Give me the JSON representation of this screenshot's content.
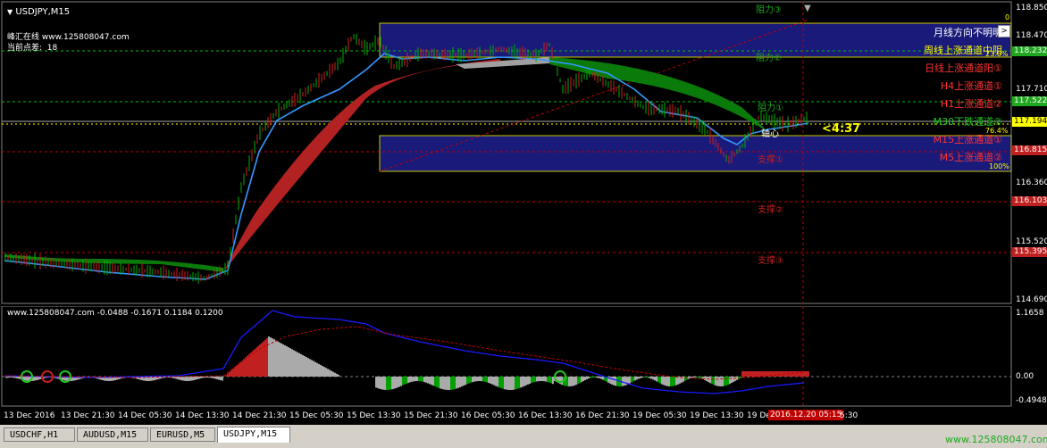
{
  "window": {
    "title": "USDJPY,M15"
  },
  "info": {
    "site": "峰汇在线 www.125808047.com",
    "spread_label": "当前点差:",
    "spread_value": "18"
  },
  "levels": {
    "res3": "阻力③",
    "res2": "阻力②",
    "res1": "阻力①",
    "pivot": "轴心",
    "sup1": "支撑①",
    "sup2": "支撑②",
    "sup3": "支撑③"
  },
  "fib": {
    "f0": "0",
    "f236": "23.6%",
    "f764": "76.4%",
    "f100": "100%"
  },
  "trend_panel": {
    "button": ">",
    "lines": [
      {
        "text": "月线方向不明明",
        "color": "#ffffff"
      },
      {
        "text": "周线上涨通道中阴",
        "color": "#ffff00"
      },
      {
        "text": "日线上涨通道阳①",
        "color": "#ff3333"
      },
      {
        "text": "H4上涨通道①",
        "color": "#ff3333"
      },
      {
        "text": "H1上涨通道②",
        "color": "#ff3333"
      },
      {
        "text": "M30下跌通道②",
        "color": "#22c322"
      },
      {
        "text": "M15上涨通道①",
        "color": "#ff3333"
      },
      {
        "text": "M5上涨通道②",
        "color": "#ff3333"
      }
    ]
  },
  "countdown": "<4:37",
  "price_axis": {
    "labels": [
      "118.850",
      "118.470",
      "118.232",
      "117.710",
      "117.522",
      "117.194",
      "116.815",
      "116.360",
      "116.103",
      "115.520",
      "115.395",
      "114.690"
    ]
  },
  "indicator": {
    "label": "www.125808047.com -0.0488 -0.1671 0.1184 0.1200",
    "axis": [
      "1.1658",
      "0.00",
      "-0.4948"
    ]
  },
  "time_axis": {
    "labels": [
      "13 Dec 2016",
      "13 Dec 21:30",
      "14 Dec 05:30",
      "14 Dec 13:30",
      "14 Dec 21:30",
      "15 Dec 05:30",
      "15 Dec 13:30",
      "15 Dec 21:30",
      "16 Dec 05:30",
      "16 Dec 13:30",
      "16 Dec 21:30",
      "19 Dec 05:30",
      "19 Dec 13:30",
      "19 De"
    ],
    "current": "2016.12.20 05:15",
    "current_tail": "5:30"
  },
  "tabs": [
    {
      "label": "USDCHF,H1",
      "active": false
    },
    {
      "label": "AUDUSD,M15",
      "active": false
    },
    {
      "label": "EURUSD,M5",
      "active": false
    },
    {
      "label": "USDJPY,M15",
      "active": true
    }
  ],
  "watermark": "www.125808047.com",
  "colors": {
    "accent_yellow": "#ffff00",
    "box_navy": "#1a1a7a",
    "bull_green": "#00a000",
    "bear_red": "#b22222",
    "ma_blue": "#3399ff"
  }
}
